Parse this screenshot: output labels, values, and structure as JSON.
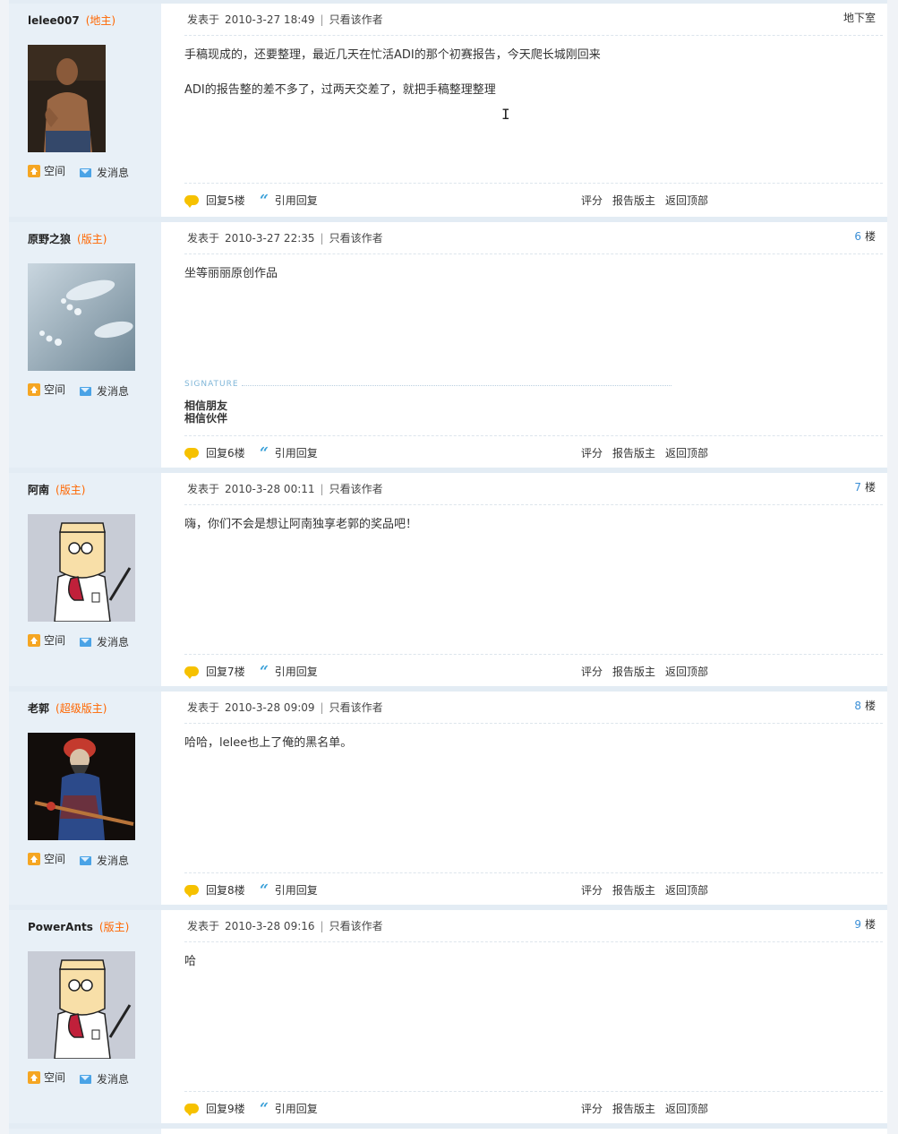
{
  "common": {
    "space_label": "空间",
    "message_label": "发消息",
    "posted_label": "发表于",
    "only_author_label": "只看该作者",
    "floor_suffix": "楼",
    "quote_reply_label": "引用回复",
    "rate_label": "评分",
    "report_label": "报告版主",
    "back_top_label": "返回顶部",
    "signature_label": "SIGNATURE"
  },
  "posts": [
    {
      "username": "lelee007",
      "role": "(地主)",
      "time": "2010-3-27 18:49",
      "floor_text": "地下室",
      "content": [
        "手稿现成的，还要整理，最近几天在忙活ADI的那个初赛报告，今天爬长城刚回来",
        "ADI的报告整的差不多了，过两天交差了，就把手稿整理整理"
      ],
      "reply_label": "回复5楼",
      "avatar": "avatar-shirtless-man"
    },
    {
      "username": "原野之狼",
      "role": "(版主)",
      "time": "2010-3-27 22:35",
      "floor_num": "6",
      "content": [
        "坐等丽丽原创作品"
      ],
      "signature": [
        "相信朋友",
        "相信伙伴"
      ],
      "reply_label": "回复6楼",
      "avatar": "avatar-water-footprints"
    },
    {
      "username": "阿南",
      "role": "(版主)",
      "time": "2010-3-28 00:11",
      "floor_num": "7",
      "content": [
        "嗨，你们不会是想让阿南独享老郭的奖品吧！"
      ],
      "reply_label": "回复7楼",
      "avatar": "avatar-cartoon-office-guy"
    },
    {
      "username": "老郭",
      "role": "(超级版主)",
      "time": "2010-3-28 09:09",
      "floor_num": "8",
      "content": [
        "哈哈，lelee也上了俺的黑名单。"
      ],
      "reply_label": "回复8楼",
      "avatar": "avatar-opera-performer"
    },
    {
      "username": "PowerAnts",
      "role": "(版主)",
      "time": "2010-3-28 09:16",
      "floor_num": "9",
      "content": [
        "哈"
      ],
      "reply_label": "回复9楼",
      "avatar": "avatar-cartoon-office-guy"
    }
  ]
}
